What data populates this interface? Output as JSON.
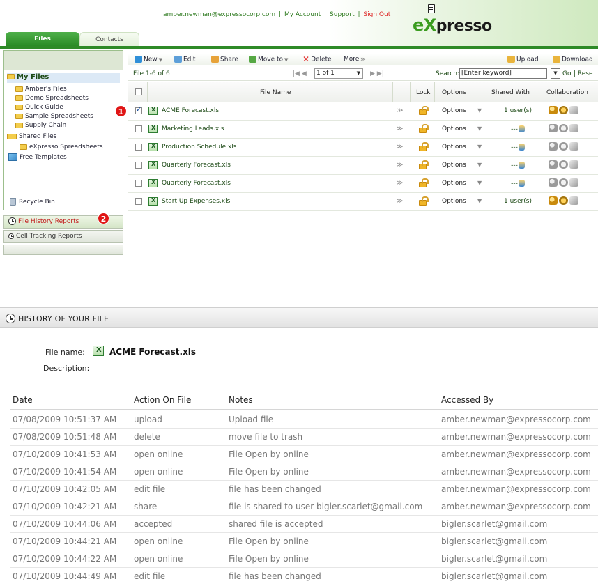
{
  "header": {
    "user_email": "amber.newman@expressocorp.com",
    "my_account": "My Account",
    "support": "Support",
    "sign_out": "Sign Out",
    "separator": "|",
    "logo_text_x": "eX",
    "logo_text_rest": "presso"
  },
  "tabs": {
    "files": "Files",
    "contacts": "Contacts"
  },
  "sidebar": {
    "my_files": "My Files",
    "items": [
      "Amber's Files",
      "Demo Spreadsheets",
      "Quick Guide",
      "Sample Spreadsheets",
      "Supply Chain"
    ],
    "shared_files": "Shared Files",
    "shared_items": [
      "eXpresso Spreadsheets"
    ],
    "free_templates": "Free Templates",
    "recycle_bin": "Recycle Bin",
    "file_history_reports": "File History Reports",
    "cell_tracking_reports": "Cell Tracking Reports"
  },
  "badges": {
    "one": "1",
    "two": "2"
  },
  "toolbar": {
    "new": "New",
    "edit": "Edit",
    "share": "Share",
    "move_to": "Move to",
    "delete": "Delete",
    "more": "More",
    "upload": "Upload",
    "download": "Download"
  },
  "pager": {
    "count": "File 1-6 of 6",
    "page_select": "1 of 1",
    "search_label": "Search:",
    "search_placeholder": "[Enter keyword]",
    "go": "Go",
    "reset": "| Rese"
  },
  "file_table": {
    "headers": {
      "file_name": "File Name",
      "lock": "Lock",
      "options": "Options",
      "shared_with": "Shared With",
      "collaboration": "Collaboration"
    },
    "rows": [
      {
        "name": "ACME Forecast.xls",
        "options": "Options",
        "shared": "1 user(s)",
        "checked": true
      },
      {
        "name": "Marketing Leads.xls",
        "options": "Options",
        "shared": "---",
        "checked": false
      },
      {
        "name": "Production Schedule.xls",
        "options": "Options",
        "shared": "---",
        "checked": false
      },
      {
        "name": "Quarterly Forecast.xls",
        "options": "Options",
        "shared": "---",
        "checked": false
      },
      {
        "name": "Quarterly Forecast.xls",
        "options": "Options",
        "shared": "---",
        "checked": false
      },
      {
        "name": "Start Up Expenses.xls",
        "options": "Options",
        "shared": "1 user(s)",
        "checked": false
      }
    ]
  },
  "history": {
    "title": "HISTORY OF YOUR FILE",
    "file_name_label": "File name:",
    "file_name_value": "ACME Forecast.xls",
    "description_label": "Description:",
    "headers": {
      "date": "Date",
      "action": "Action On File",
      "notes": "Notes",
      "accessed_by": "Accessed By"
    },
    "rows": [
      {
        "date": "07/08/2009 10:51:37 AM",
        "action": "upload",
        "notes": "Upload file",
        "by": "amber.newman@expressocorp.com"
      },
      {
        "date": "07/08/2009 10:51:48 AM",
        "action": "delete",
        "notes": "move file to trash",
        "by": "amber.newman@expressocorp.com"
      },
      {
        "date": "07/10/2009 10:41:53 AM",
        "action": "open online",
        "notes": "File Open by online",
        "by": "amber.newman@expressocorp.com"
      },
      {
        "date": "07/10/2009 10:41:54 AM",
        "action": "open online",
        "notes": "File Open by online",
        "by": "amber.newman@expressocorp.com"
      },
      {
        "date": "07/10/2009 10:42:05 AM",
        "action": "edit file",
        "notes": "file has been changed",
        "by": "amber.newman@expressocorp.com"
      },
      {
        "date": "07/10/2009 10:42:21 AM",
        "action": "share",
        "notes": "file is shared to user bigler.scarlet@gmail.com",
        "by": "amber.newman@expressocorp.com"
      },
      {
        "date": "07/10/2009 10:44:06 AM",
        "action": "accepted",
        "notes": "shared file is accepted",
        "by": "bigler.scarlet@gmail.com"
      },
      {
        "date": "07/10/2009 10:44:21 AM",
        "action": "open online",
        "notes": "File Open by online",
        "by": "bigler.scarlet@gmail.com"
      },
      {
        "date": "07/10/2009 10:44:22 AM",
        "action": "open online",
        "notes": "File Open by online",
        "by": "bigler.scarlet@gmail.com"
      },
      {
        "date": "07/10/2009 10:44:49 AM",
        "action": "edit file",
        "notes": "file has been changed",
        "by": "bigler.scarlet@gmail.com"
      }
    ]
  }
}
